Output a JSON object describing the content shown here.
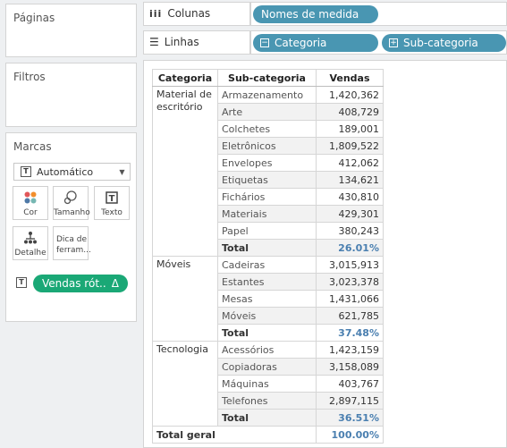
{
  "pages_panel": {
    "title": "Páginas"
  },
  "filters_panel": {
    "title": "Filtros"
  },
  "marks_panel": {
    "title": "Marcas",
    "mark_type": "Automático",
    "buttons": {
      "color": "Cor",
      "size": "Tamanho",
      "text": "Texto",
      "detail": "Detalhe",
      "tooltip": "Dica de ferram..."
    },
    "label_pill": "Vendas rót..",
    "label_pill_delta": "Δ"
  },
  "columns_shelf": {
    "label": "Colunas",
    "pills": [
      "Nomes de medida"
    ]
  },
  "rows_shelf": {
    "label": "Linhas",
    "pills": [
      "Categoria",
      "Sub-categoria"
    ]
  },
  "table": {
    "headers": [
      "Categoria",
      "Sub-categoria",
      "Vendas"
    ],
    "groups": [
      {
        "category": "Material de escritório",
        "rows": [
          [
            "Armazenamento",
            "1,420,362"
          ],
          [
            "Arte",
            "408,729"
          ],
          [
            "Colchetes",
            "189,001"
          ],
          [
            "Eletrônicos",
            "1,809,522"
          ],
          [
            "Envelopes",
            "412,062"
          ],
          [
            "Etiquetas",
            "134,621"
          ],
          [
            "Fichários",
            "430,810"
          ],
          [
            "Materiais",
            "429,301"
          ],
          [
            "Papel",
            "380,243"
          ]
        ],
        "total_label": "Total",
        "total_value": "26.01%"
      },
      {
        "category": "Móveis",
        "rows": [
          [
            "Cadeiras",
            "3,015,913"
          ],
          [
            "Estantes",
            "3,023,378"
          ],
          [
            "Mesas",
            "1,431,066"
          ],
          [
            "Móveis",
            "621,785"
          ]
        ],
        "total_label": "Total",
        "total_value": "37.48%"
      },
      {
        "category": "Tecnologia",
        "rows": [
          [
            "Acessórios",
            "1,423,159"
          ],
          [
            "Copiadoras",
            "3,158,089"
          ],
          [
            "Máquinas",
            "403,767"
          ],
          [
            "Telefones",
            "2,897,115"
          ]
        ],
        "total_label": "Total",
        "total_value": "36.51%"
      }
    ],
    "grand_total_label": "Total geral",
    "grand_total_value": "100.00%"
  }
}
